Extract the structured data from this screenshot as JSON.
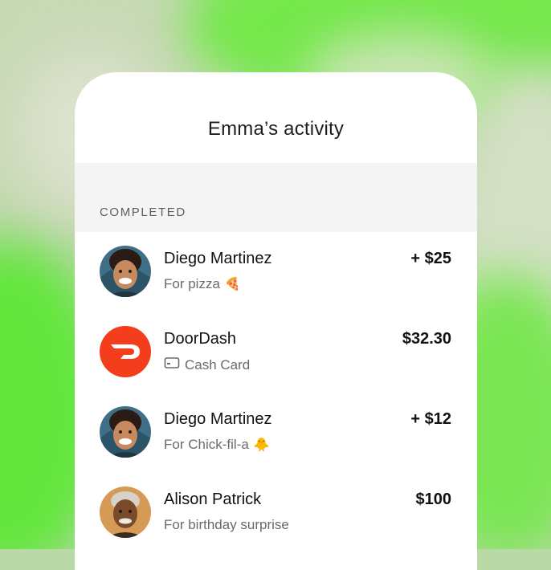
{
  "screen": {
    "title": "Emma’s activity",
    "section_label": "COMPLETED"
  },
  "transactions": [
    {
      "name": "Diego Martinez",
      "note": "For pizza",
      "emoji": "🍕",
      "amount": "+ $25",
      "avatar": "person-photo"
    },
    {
      "name": "DoorDash",
      "note": "Cash Card",
      "emoji": "",
      "amount": "$32.30",
      "avatar": "doordash-logo"
    },
    {
      "name": "Diego Martinez",
      "note": "For Chick-fil-a",
      "emoji": "🐥",
      "amount": "+ $12",
      "avatar": "person-photo"
    },
    {
      "name": "Alison Patrick",
      "note": "For birthday surprise",
      "emoji": "",
      "amount": "$100",
      "avatar": "person-photo"
    }
  ],
  "colors": {
    "accent_green": "#62e63c",
    "doordash_red": "#f33d1d"
  }
}
